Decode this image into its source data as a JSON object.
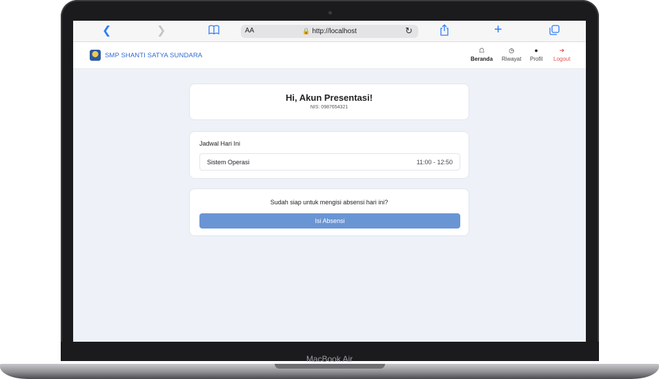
{
  "device": {
    "model_label": "MacBook Air"
  },
  "browser": {
    "text_size_label": "AA",
    "url": "http://localhost",
    "icons": [
      "back-icon",
      "forward-icon",
      "bookmarks-icon",
      "reload-icon",
      "share-icon",
      "new-tab-icon",
      "tabs-icon"
    ]
  },
  "navbar": {
    "brand": "SMP SHANTI SATYA SUNDARA",
    "items": [
      {
        "label": "Beranda",
        "icon": "home-icon",
        "active": true
      },
      {
        "label": "Riwayat",
        "icon": "clock-icon"
      },
      {
        "label": "Profil",
        "icon": "user-icon"
      },
      {
        "label": "Logout",
        "icon": "logout-icon"
      }
    ],
    "colors": {
      "brand": "#2f6bd0",
      "logout": "#e05252"
    }
  },
  "greeting": {
    "title": "Hi, Akun Presentasi!",
    "nis": "NIS: 0987654321"
  },
  "schedule": {
    "title": "Jadwal Hari Ini",
    "items": [
      {
        "subject": "Sistem Operasi",
        "time": "11:00 - 12:50"
      }
    ]
  },
  "attendance": {
    "question": "Sudah siap untuk mengisi absensi hari ini?",
    "button_label": "Isi Absensi",
    "button_color": "#6a95d4"
  }
}
